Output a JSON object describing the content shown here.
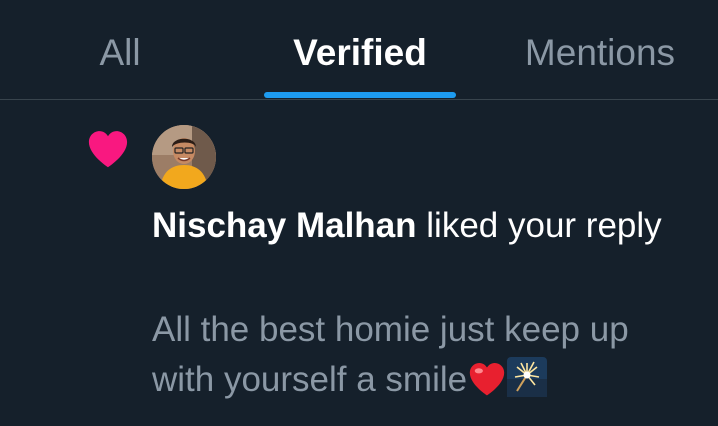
{
  "tabs": [
    {
      "label": "All",
      "active": false
    },
    {
      "label": "Verified",
      "active": true
    },
    {
      "label": "Mentions",
      "active": false
    }
  ],
  "colors": {
    "background": "#15202b",
    "accent": "#1d9bf0",
    "heart": "#f91880",
    "muted_text": "#8b98a5",
    "divider": "#38444d"
  },
  "notification": {
    "icon": "heart-icon",
    "avatar": "user-avatar",
    "user_name": "Nischay Malhan",
    "action_text": " liked your reply",
    "reply_text": "All the best homie just keep up with yourself a smile",
    "emojis": [
      "red-heart-emoji",
      "sparkler-emoji"
    ]
  }
}
